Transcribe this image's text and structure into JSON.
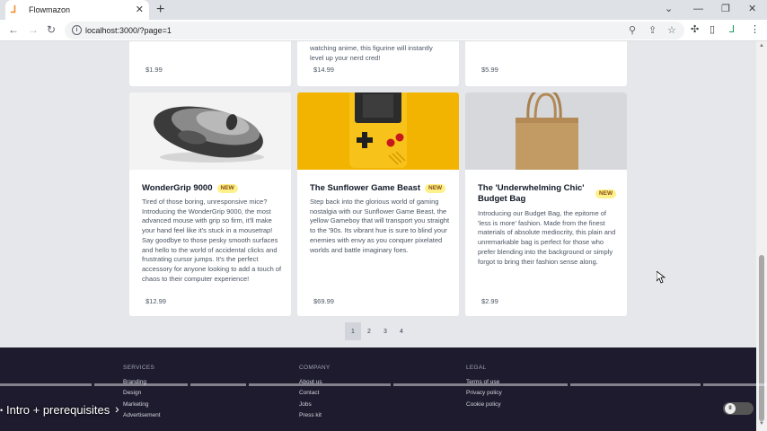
{
  "browser": {
    "tab_title": "Flowmazon",
    "url": "localhost:3000/?page=1"
  },
  "products_top_partial": [
    {
      "desc_lines": [],
      "price": "$1.99"
    },
    {
      "desc_lines": [
        "watching anime, this figurine will instantly",
        "level up your nerd cred!"
      ],
      "price": "$14.99"
    },
    {
      "desc_lines": [],
      "price": "$5.99"
    }
  ],
  "products": [
    {
      "name": "WonderGrip 9000",
      "badge": "NEW",
      "description": "Tired of those boring, unresponsive mice? Introducing the WonderGrip 9000, the most advanced mouse with grip so firm, it'll make your hand feel like it's stuck in a mousetrap! Say goodbye to those pesky smooth surfaces and hello to the world of accidental clicks and frustrating cursor jumps. It's the perfect accessory for anyone looking to add a touch of chaos to their computer experience!",
      "price": "$12.99"
    },
    {
      "name": "The Sunflower Game Beast",
      "badge": "NEW",
      "description": "Step back into the glorious world of gaming nostalgia with our Sunflower Game Beast, the yellow Gameboy that will transport you straight to the '90s. Its vibrant hue is sure to blind your enemies with envy as you conquer pixelated worlds and battle imaginary foes.",
      "price": "$69.99"
    },
    {
      "name": "The 'Underwhelming Chic' Budget Bag",
      "badge": "NEW",
      "description": "Introducing our Budget Bag, the epitome of 'less is more' fashion. Made from the finest materials of absolute mediocrity, this plain and unremarkable bag is perfect for those who prefer blending into the background or simply forgot to bring their fashion sense along.",
      "price": "$2.99"
    }
  ],
  "pagination": [
    "1",
    "2",
    "3",
    "4"
  ],
  "pagination_active": "1",
  "footer": {
    "services": {
      "heading": "SERVICES",
      "links": [
        "Branding",
        "Design",
        "Marketing",
        "Advertisement"
      ]
    },
    "company": {
      "heading": "COMPANY",
      "links": [
        "About us",
        "Contact",
        "Jobs",
        "Press kit"
      ]
    },
    "legal": {
      "heading": "LEGAL",
      "links": [
        "Terms of use",
        "Privacy policy",
        "Cookie policy"
      ]
    }
  },
  "video": {
    "chapter_title": "Intro + prerequisites"
  }
}
